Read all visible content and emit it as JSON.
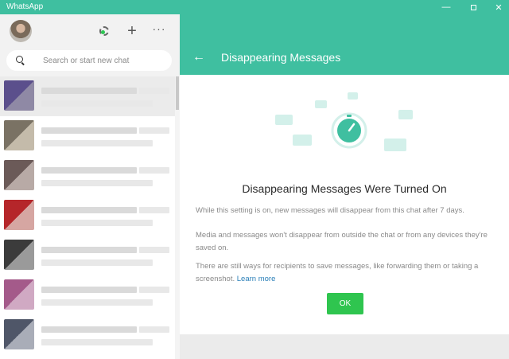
{
  "window": {
    "title": "WhatsApp",
    "controls": [
      "minimize-icon",
      "maximize-icon",
      "close-icon"
    ]
  },
  "sidebar": {
    "icons": [
      "status-icon",
      "new-chat-icon",
      "more-options-icon"
    ],
    "search": {
      "placeholder": "Search or start new chat",
      "value": ""
    },
    "chats_note": "chat list contents are pixelated / unreadable"
  },
  "main": {
    "header_title": "Disappearing Messages",
    "heading": "Disappearing Messages Were Turned On",
    "paragraph1": "While this setting is on, new messages will disappear from this chat after 7 days.",
    "paragraph2": "Media and messages won't disappear from outside the chat or from any devices they're saved on.",
    "paragraph3": "There are still ways for recipients to save messages, like forwarding them or taking a screenshot.",
    "learn_more": "Learn more",
    "ok_label": "OK"
  },
  "colors": {
    "accent": "#3fbfa0",
    "ok_button": "#2fc54f",
    "link": "#2a7fb8"
  }
}
